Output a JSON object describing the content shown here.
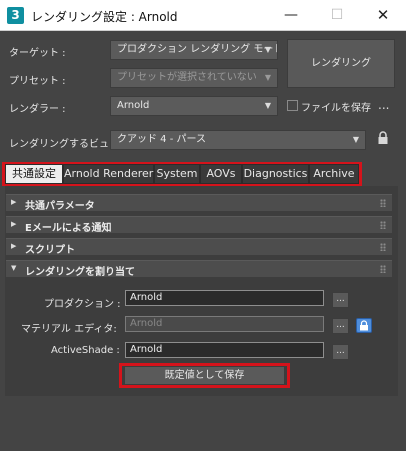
{
  "window": {
    "app_icon": "3",
    "title": "レンダリング設定 : Arnold",
    "minimize": "—",
    "maximize": "☐",
    "close": "✕"
  },
  "form": {
    "target_label": "ターゲット :",
    "target_value": "プロダクション レンダリング モード",
    "preset_label": "プリセット :",
    "preset_value": "プリセットが選択されていない",
    "renderer_label": "レンダラー :",
    "renderer_value": "Arnold",
    "save_file_label": "ファイルを保存",
    "view_label": "レンダリングするビュー :",
    "view_value": "クアッド 4 - パース",
    "render_button": "レンダリング",
    "more": "..."
  },
  "tabs": [
    {
      "label": "共通設定"
    },
    {
      "label": "Arnold Renderer"
    },
    {
      "label": "System"
    },
    {
      "label": "AOVs"
    },
    {
      "label": "Diagnostics"
    },
    {
      "label": "Archive"
    }
  ],
  "rollouts": [
    {
      "label": "共通パラメータ",
      "expanded": false
    },
    {
      "label": "Eメールによる通知",
      "expanded": false
    },
    {
      "label": "スクリプト",
      "expanded": false
    },
    {
      "label": "レンダリングを割り当て",
      "expanded": true
    }
  ],
  "assign": {
    "production_label": "プロダクション :",
    "production_value": "Arnold",
    "material_label": "マテリアル エディタ:",
    "material_value": "Arnold",
    "activeshade_label": "ActiveShade :",
    "activeshade_value": "Arnold",
    "browse": "...",
    "save_default": "既定値として保存"
  },
  "colors": {
    "highlight": "#d5131b",
    "lock_button": "#4f8edc",
    "app_icon": "#0f8fa0"
  }
}
